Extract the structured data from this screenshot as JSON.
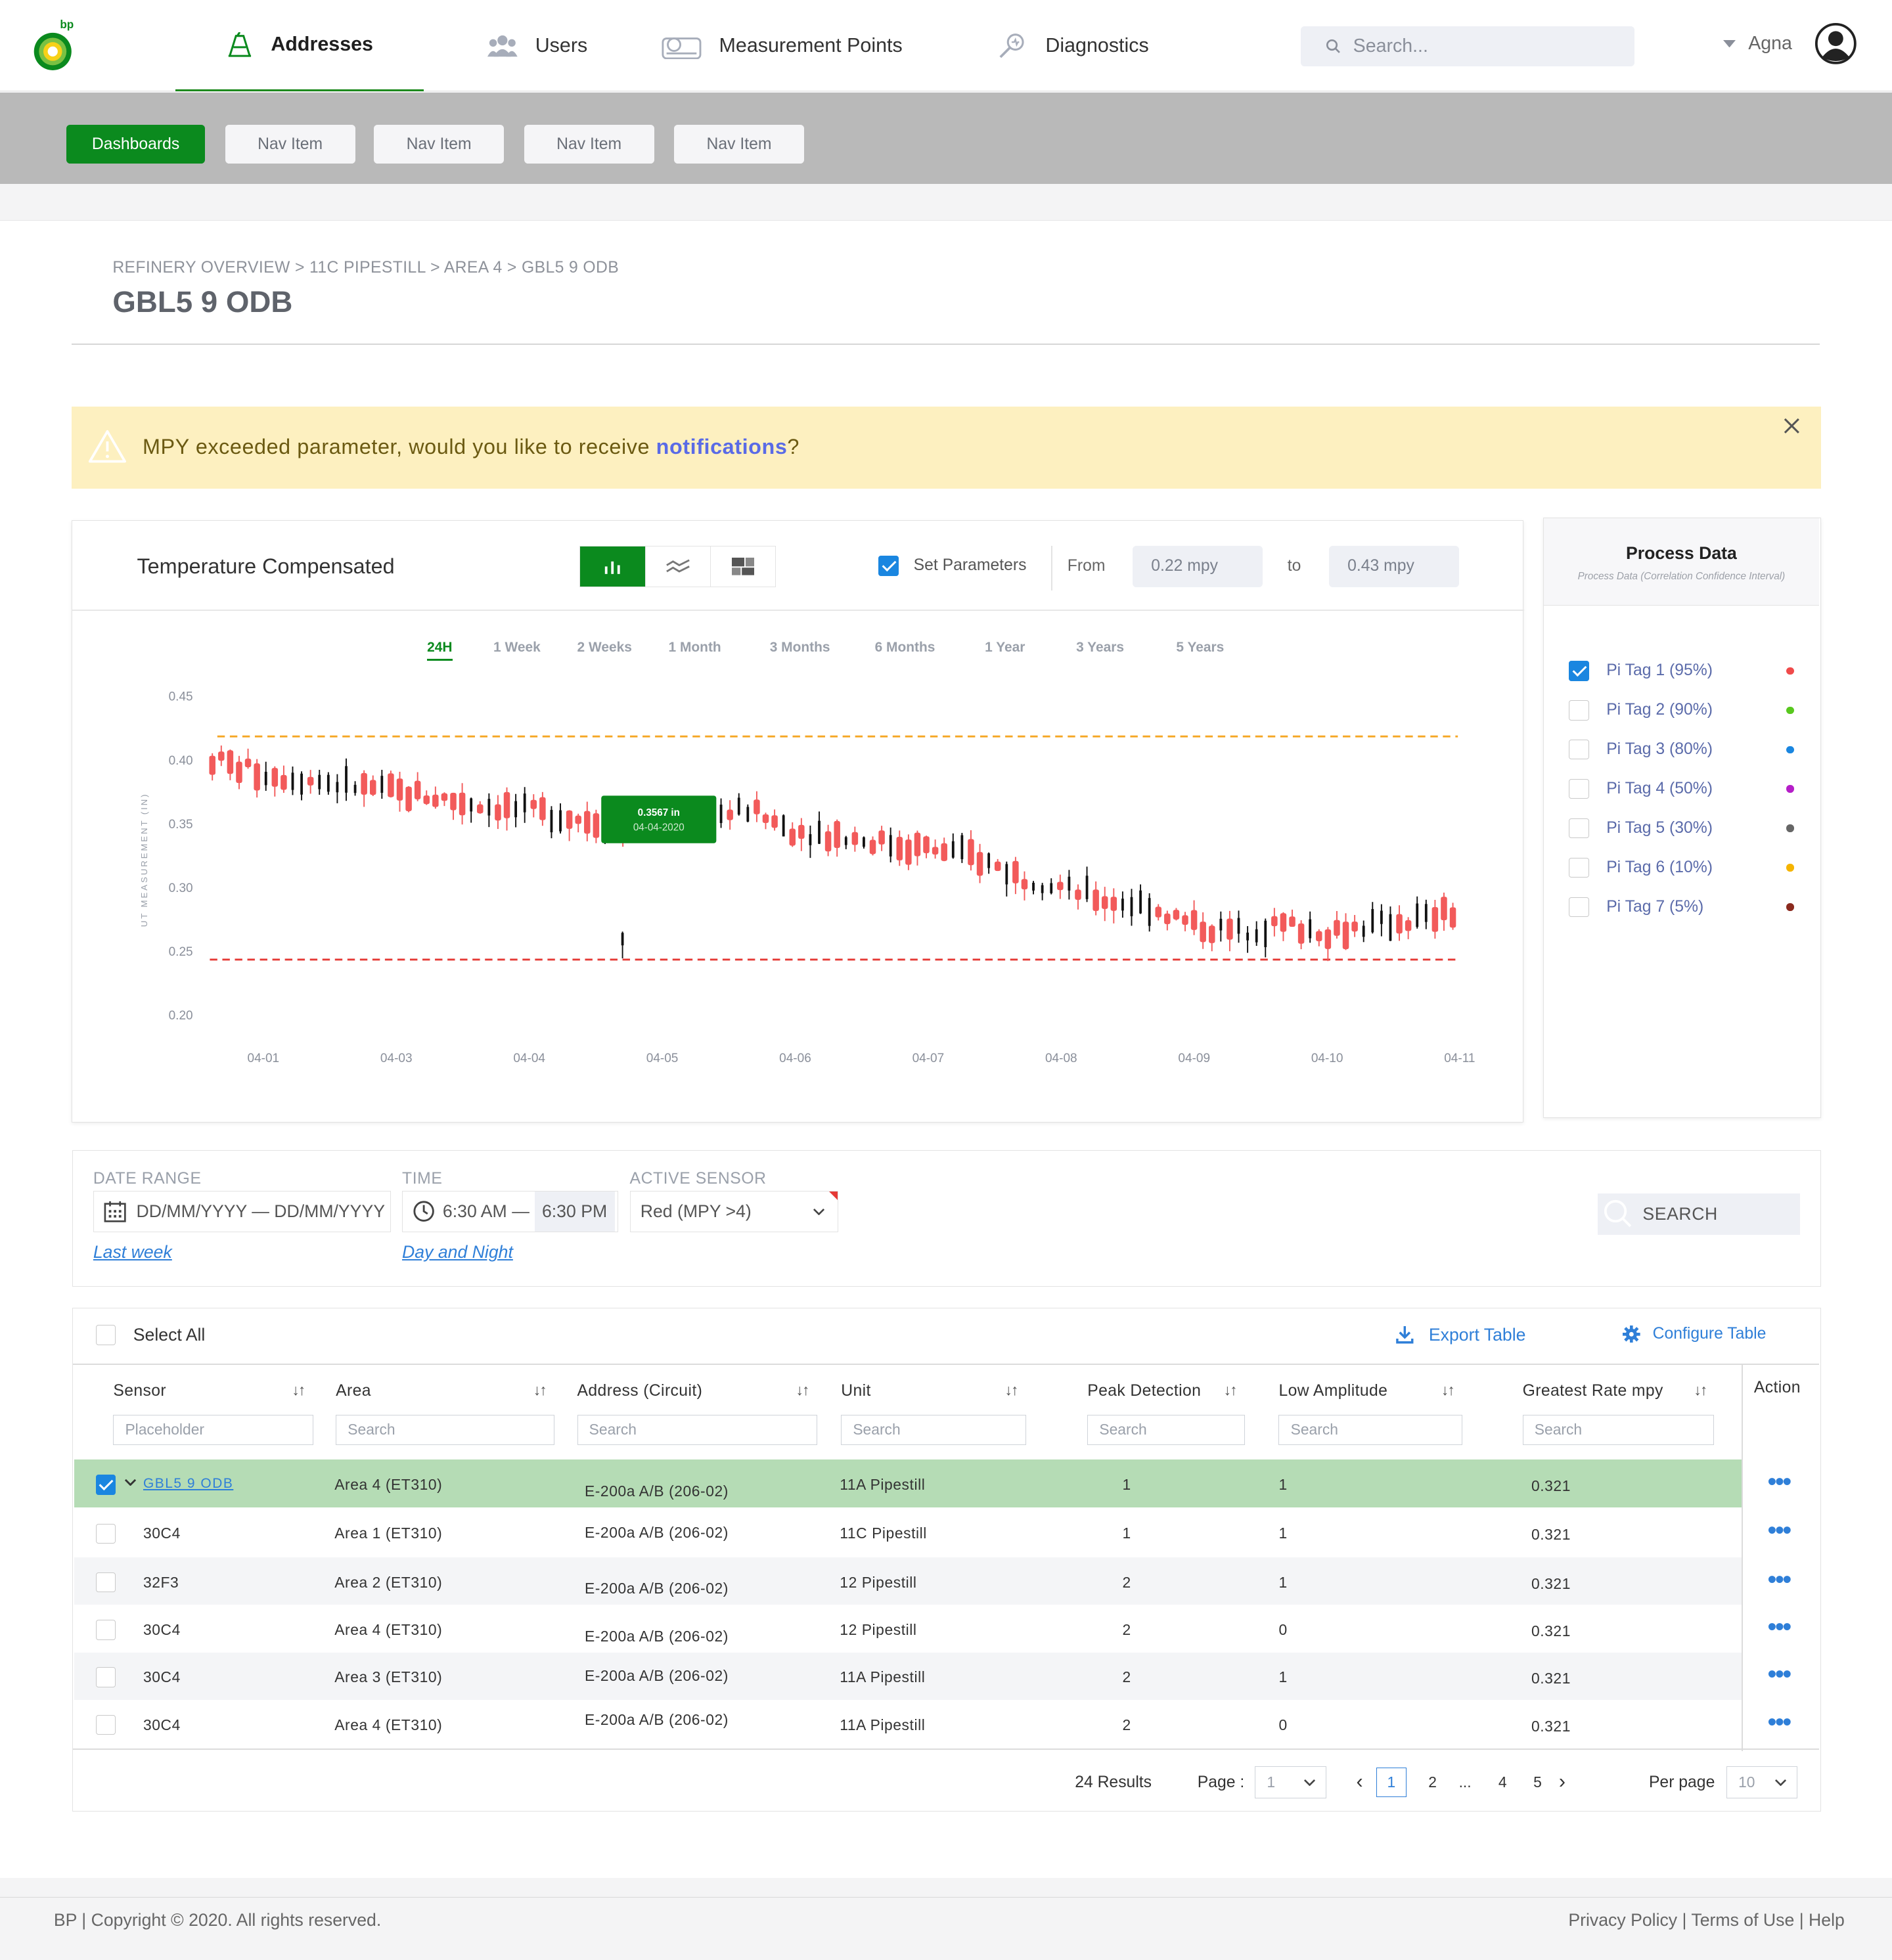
{
  "nav": {
    "logo_text": "bp",
    "items": [
      {
        "label": "Addresses",
        "icon": "oil-rig-icon"
      },
      {
        "label": "Users",
        "icon": "users-icon"
      },
      {
        "label": "Measurement Points",
        "icon": "gauge-icon"
      },
      {
        "label": "Diagnostics",
        "icon": "diagnostics-icon"
      }
    ],
    "search_placeholder": "Search...",
    "user_name": "Agna"
  },
  "subnav": {
    "active": "Dashboards",
    "items": [
      "Nav Item",
      "Nav Item",
      "Nav Item",
      "Nav Item"
    ]
  },
  "page": {
    "breadcrumb": "REFINERY OVERVIEW > 11C PIPESTILL > AREA 4 > GBL5 9 ODB",
    "title": "GBL5 9 ODB"
  },
  "alert": {
    "message": "MPY exceeded parameter, would you like to receive ",
    "link": "notifications",
    "suffix": "?"
  },
  "chart_panel": {
    "title": "Temperature Compensated",
    "set_parameters_label": "Set Parameters",
    "set_parameters_checked": true,
    "from_label": "From",
    "from_value": "0.22 mpy",
    "to_label": "to",
    "to_value": "0.43 mpy",
    "ranges": [
      "24H",
      "1 Week",
      "2 Weeks",
      "1 Month",
      "3 Months",
      "6 Months",
      "1 Year",
      "3 Years",
      "5 Years"
    ],
    "active_range": "24H",
    "tooltip_value": "0.3567 in",
    "tooltip_date": "04-04-2020"
  },
  "chart_data": {
    "type": "candlestick",
    "ylabel": "UT MEASUREMENT (IN)",
    "ylim": [
      0.2,
      0.45
    ],
    "yticks": [
      "0.45",
      "0.40",
      "0.35",
      "0.30",
      "0.25",
      "0.20"
    ],
    "xticks": [
      "04-01",
      "04-03",
      "04-04",
      "04-05",
      "04-06",
      "04-07",
      "04-08",
      "04-09",
      "04-10",
      "04-11"
    ],
    "upper_threshold": 0.418,
    "lower_threshold": 0.243,
    "colors": {
      "upper_threshold": "#f5a623",
      "lower_threshold": "#e53935",
      "up": "#f25a5a",
      "down": "#111111",
      "tooltip": "#0b8a1e"
    },
    "trend": [
      [
        0,
        0.4
      ],
      [
        5,
        0.39
      ],
      [
        10,
        0.385
      ],
      [
        15,
        0.38
      ],
      [
        20,
        0.375
      ],
      [
        25,
        0.37
      ],
      [
        30,
        0.365
      ],
      [
        35,
        0.36
      ],
      [
        40,
        0.355
      ],
      [
        45,
        0.35
      ],
      [
        50,
        0.35
      ],
      [
        55,
        0.355
      ],
      [
        60,
        0.36
      ],
      [
        65,
        0.345
      ],
      [
        70,
        0.34
      ],
      [
        75,
        0.335
      ],
      [
        80,
        0.33
      ],
      [
        85,
        0.325
      ],
      [
        90,
        0.31
      ],
      [
        95,
        0.3
      ],
      [
        100,
        0.29
      ],
      [
        105,
        0.285
      ],
      [
        110,
        0.27
      ],
      [
        115,
        0.265
      ],
      [
        120,
        0.27
      ],
      [
        125,
        0.265
      ],
      [
        130,
        0.27
      ],
      [
        135,
        0.275
      ],
      [
        140,
        0.28
      ]
    ]
  },
  "process_data": {
    "title": "Process Data",
    "subtitle": "Process Data   (Correlation Confidence Interval)",
    "tags": [
      {
        "label": "Pi Tag  1 (95%)",
        "checked": true,
        "color": "#f04a4a"
      },
      {
        "label": "Pi Tag  2 (90%)",
        "checked": false,
        "color": "#58c81e"
      },
      {
        "label": "Pi Tag 3 (80%)",
        "checked": false,
        "color": "#1a86e0"
      },
      {
        "label": "Pi Tag  4 (50%)",
        "checked": false,
        "color": "#b51ec8"
      },
      {
        "label": "Pi Tag  5 (30%)",
        "checked": false,
        "color": "#666666"
      },
      {
        "label": "Pi Tag  6 (10%)",
        "checked": false,
        "color": "#f5b400"
      },
      {
        "label": "Pi Tag 7 (5%)",
        "checked": false,
        "color": "#8b2a1e"
      }
    ]
  },
  "filters": {
    "date_range_label": "DATE RANGE",
    "date_range_value": "DD/MM/YYYY — DD/MM/YYYY",
    "date_link": "Last week",
    "time_label": "TIME",
    "time_from": "6:30 AM",
    "time_sep": "—",
    "time_to": "6:30 PM",
    "time_link": "Day and Night",
    "sensor_label": "ACTIVE SENSOR",
    "sensor_value": "Red (MPY >4)",
    "search_label": "SEARCH"
  },
  "table": {
    "select_all": "Select All",
    "export_label": "Export Table",
    "configure_label": "Configure Table",
    "sort_glyph": "↓↑",
    "columns": [
      "Sensor",
      "Area",
      "Address (Circuit)",
      "Unit",
      "Peak Detection",
      "Low Amplitude",
      "Greatest Rate mpy",
      "Action"
    ],
    "filter_placeholders": [
      "Placeholder",
      "Search",
      "Search",
      "Search",
      "Search",
      "Search",
      "Search"
    ],
    "rows": [
      {
        "sensor": "GBL5 9 ODB",
        "area": "Area 4 (ET310)",
        "address": "E-200a A/B (206-02)",
        "unit": "11A Pipestill",
        "peak": "1",
        "low": "1",
        "rate": "0.321",
        "selected": true
      },
      {
        "sensor": "30C4",
        "area": "Area 1 (ET310)",
        "address": "E-200a A/B (206-02)",
        "unit": "11C Pipestill",
        "peak": "1",
        "low": "1",
        "rate": "0.321",
        "selected": false
      },
      {
        "sensor": "32F3",
        "area": "Area 2 (ET310)",
        "address": "E-200a A/B (206-02)",
        "unit": "12 Pipestill",
        "peak": "2",
        "low": "1",
        "rate": "0.321",
        "selected": false
      },
      {
        "sensor": "30C4",
        "area": "Area 4 (ET310)",
        "address": "E-200a A/B (206-02)",
        "unit": "12 Pipestill",
        "peak": "2",
        "low": "0",
        "rate": "0.321",
        "selected": false
      },
      {
        "sensor": "30C4",
        "area": "Area 3 (ET310)",
        "address": "E-200a A/B (206-02)",
        "unit": "11A Pipestill",
        "peak": "2",
        "low": "1",
        "rate": "0.321",
        "selected": false
      },
      {
        "sensor": "30C4",
        "area": "Area 4 (ET310)",
        "address": "E-200a A/B (206-02)",
        "unit": "11A Pipestill",
        "peak": "2",
        "low": "0",
        "rate": "0.321",
        "selected": false
      }
    ],
    "action_glyph": "•••"
  },
  "pagination": {
    "results": "24 Results",
    "page_label": "Page :",
    "page_value": "1",
    "pages": [
      "1",
      "2",
      "...",
      "4",
      "5"
    ],
    "current": "1",
    "prev": "‹",
    "next": "›",
    "per_page_label": "Per page",
    "per_page_value": "10"
  },
  "footer": {
    "left": "BP |  Copyright © 2020. All rights reserved.",
    "right": "Privacy Policy | Terms of Use | Help"
  }
}
